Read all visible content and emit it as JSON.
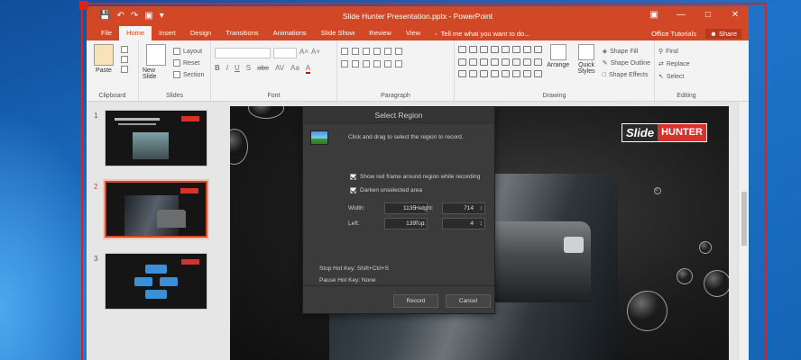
{
  "window": {
    "title": "Slide Hunter Presentation.pptx - PowerPoint"
  },
  "tabs": [
    "File",
    "Home",
    "Insert",
    "Design",
    "Transitions",
    "Animations",
    "Slide Show",
    "Review",
    "View"
  ],
  "tell_me": "Tell me what you want to do...",
  "account": {
    "name": "Office Tutorials",
    "share": "Share"
  },
  "ribbon": {
    "clipboard": {
      "paste": "Paste",
      "label": "Clipboard"
    },
    "slides": {
      "new_slide": "New Slide",
      "layout": "Layout",
      "reset": "Reset",
      "section": "Section",
      "label": "Slides"
    },
    "font": {
      "label": "Font",
      "format_buttons": [
        "B",
        "I",
        "U",
        "S",
        "abc",
        "AV",
        "Aa",
        "A"
      ]
    },
    "paragraph": {
      "label": "Paragraph"
    },
    "drawing": {
      "arrange": "Arrange",
      "quick_styles": "Quick Styles",
      "shape_fill": "Shape Fill",
      "shape_outline": "Shape Outline",
      "shape_effects": "Shape Effects",
      "label": "Drawing"
    },
    "editing": {
      "find": "Find",
      "replace": "Replace",
      "select": "Select",
      "label": "Editing"
    }
  },
  "thumbnails": [
    {
      "number": "1",
      "selected": false
    },
    {
      "number": "2",
      "selected": true
    },
    {
      "number": "3",
      "selected": false
    }
  ],
  "slide": {
    "logo_left": "Slide",
    "logo_right": "HUNTER"
  },
  "dialog": {
    "title": "Select Region",
    "description": "Click and drag to select the region to record.",
    "checkbox_frame": "Show red frame around region while recording",
    "checkbox_darken": "Darken unselected area",
    "width_label": "Width:",
    "width_value": "1135",
    "height_label": "Height:",
    "height_value": "714",
    "left_label": "Left:",
    "left_value": "139",
    "top_label": "Top:",
    "top_value": "4",
    "stop_hotkey": "Stop Hot Key: Shift+Ctrl+S",
    "pause_hotkey": "Pause Hot Key: None",
    "record_button": "Record",
    "cancel_button": "Cancel"
  },
  "colors": {
    "accent": "#d24726",
    "record_frame": "#e0201a",
    "dialog_bg": "#3b3b3b"
  }
}
